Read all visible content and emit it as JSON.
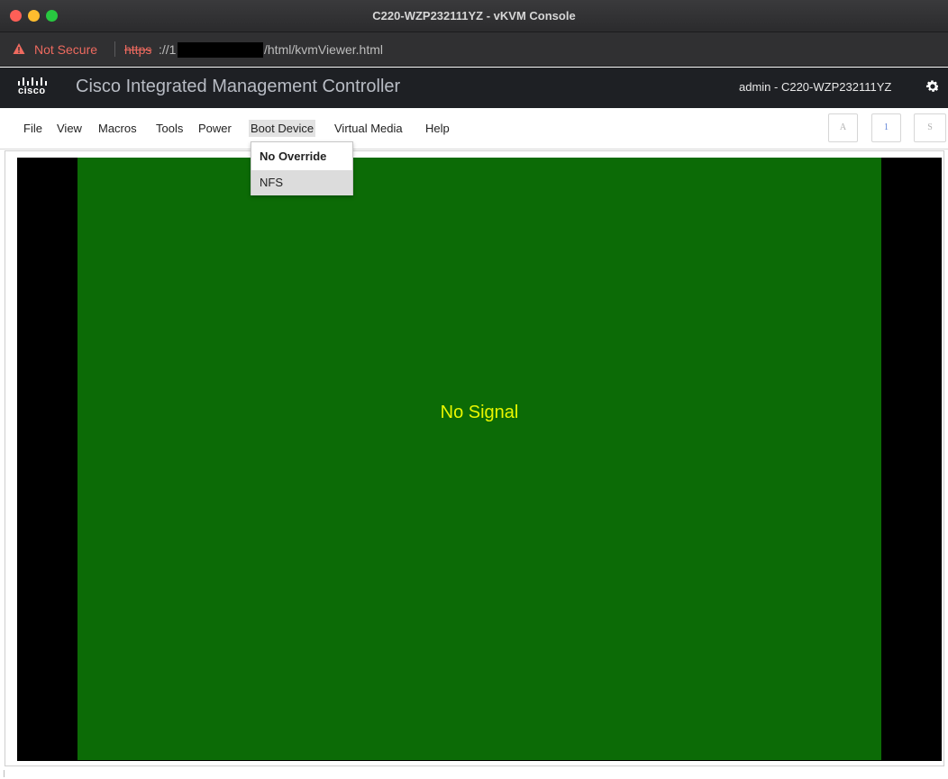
{
  "window": {
    "title": "C220-WZP232111YZ - vKVM Console"
  },
  "address_bar": {
    "security_label": "Not Secure",
    "url_scheme": "https",
    "url_sep": "://1",
    "url_path": "/html/kvmViewer.html"
  },
  "header": {
    "brand": "cisco",
    "app_title": "Cisco Integrated Management Controller",
    "user_host": "admin - C220-WZP232111YZ"
  },
  "menu": {
    "items": [
      "File",
      "View",
      "Macros",
      "Tools",
      "Power",
      "Boot Device",
      "Virtual Media",
      "Help"
    ],
    "active_item": "Boot Device"
  },
  "keyboard_indicators": {
    "a": "A",
    "num": "1",
    "s": "S"
  },
  "boot_device_menu": {
    "items": [
      "No Override",
      "NFS"
    ],
    "selected": "No Override",
    "hovered": "NFS"
  },
  "kvm": {
    "status_text": "No Signal"
  },
  "colors": {
    "kvm_green": "#0c6b06",
    "no_signal_text": "#e9f700",
    "not_secure": "#ee6a5f"
  }
}
